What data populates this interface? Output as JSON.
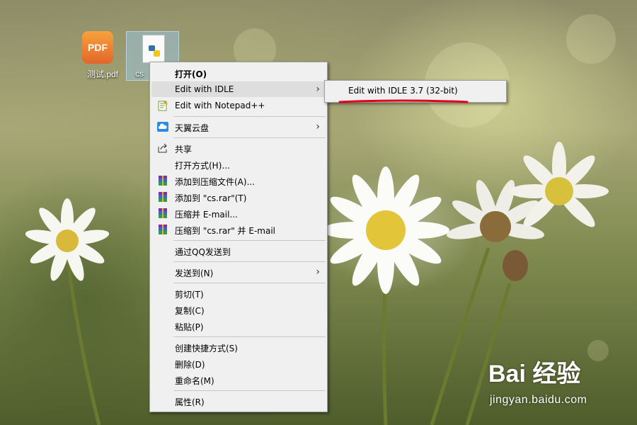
{
  "desktop": {
    "icons": [
      {
        "label": "测试.pdf",
        "glyph": "PDF",
        "icon": "pdf-file-icon"
      },
      {
        "label": "cs",
        "icon": "python-file-icon"
      }
    ]
  },
  "context_menu": {
    "items": [
      {
        "label": "打开(O)"
      },
      {
        "label": "Edit with IDLE",
        "icon": "idle-icon",
        "submenu_arrow": "›"
      },
      {
        "label": "Edit with Notepad++",
        "icon": "notepadpp-icon"
      },
      {
        "label": "天翼云盘",
        "icon": "cloud-icon",
        "submenu_arrow": "›"
      },
      {
        "label": "共享",
        "icon": "share-icon"
      },
      {
        "label": "打开方式(H)..."
      },
      {
        "label": "添加到压缩文件(A)...",
        "icon": "winrar-icon"
      },
      {
        "label": "添加到 \"cs.rar\"(T)",
        "icon": "winrar-icon"
      },
      {
        "label": "压缩并 E-mail...",
        "icon": "winrar-icon"
      },
      {
        "label": "压缩到 \"cs.rar\" 并 E-mail",
        "icon": "winrar-icon"
      },
      {
        "label": "通过QQ发送到"
      },
      {
        "label": "发送到(N)",
        "submenu_arrow": "›"
      },
      {
        "label": "剪切(T)"
      },
      {
        "label": "复制(C)"
      },
      {
        "label": "粘贴(P)"
      },
      {
        "label": "创建快捷方式(S)"
      },
      {
        "label": "删除(D)"
      },
      {
        "label": "重命名(M)"
      },
      {
        "label": "属性(R)"
      }
    ]
  },
  "submenu": {
    "items": [
      {
        "label": "Edit with IDLE 3.7 (32-bit)"
      }
    ],
    "highlight_color": "#e0001a"
  },
  "watermark": {
    "logo": "Bai 经验",
    "url": "jingyan.baidu.com"
  }
}
